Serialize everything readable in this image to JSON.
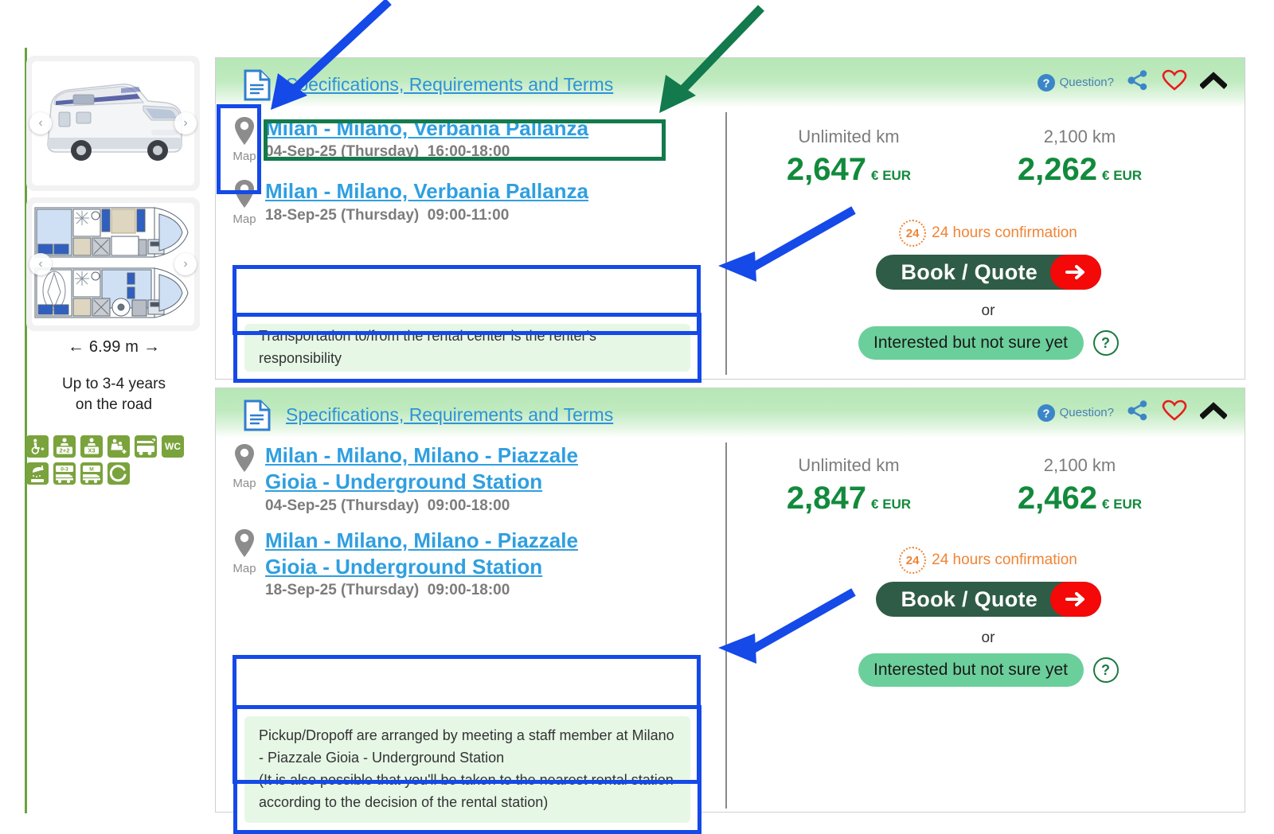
{
  "sidebar": {
    "vehicle_photo_alt": "motorhome-exterior-photo",
    "floorplan_alt": "motorhome-floorplan",
    "prev_label": "‹",
    "next_label": "›",
    "length_text": "6.99 m",
    "length_arrow_left": "←",
    "length_arrow_right": "→",
    "age_line1": "Up to 3-4 years",
    "age_line2": "on the road",
    "badges": [
      {
        "name": "wheelchair-plus-icon",
        "text": ""
      },
      {
        "name": "berths-2plus2-icon",
        "text": "2+2"
      },
      {
        "name": "seats-x3-icon",
        "text": "X3"
      },
      {
        "name": "family-plus-icon",
        "text": ""
      },
      {
        "name": "vehicle-length-icon",
        "text": ""
      },
      {
        "name": "toilet-wc-icon",
        "text": "WC"
      },
      {
        "name": "shower-icon",
        "text": ""
      },
      {
        "name": "age-0-3-icon",
        "text": "0-3"
      },
      {
        "name": "manual-transmission-icon",
        "text": "M"
      },
      {
        "name": "refresh-c-icon",
        "text": "C"
      }
    ]
  },
  "listings": [
    {
      "header": {
        "spec_link": "Specifications, Requirements and Terms",
        "question_label": "Question?",
        "doc_icon": "document-icon",
        "share_icon": "share-icon",
        "favorite_icon": "heart-icon",
        "collapse_icon": "chevron-up-icon"
      },
      "pickup": {
        "name": "Milan - Milano, Verbania Pallanza",
        "name_line2": "",
        "map_label": "Map",
        "date": "04-Sep-25 (Thursday)",
        "time": "16:00-18:00"
      },
      "dropoff": {
        "name": "Milan - Milano, Verbania Pallanza",
        "name_line2": "",
        "map_label": "Map",
        "date": "18-Sep-25 (Thursday)",
        "time": "09:00-11:00"
      },
      "note": "Transportation to/from the rental center is the renter's responsibility",
      "prices": [
        {
          "km_label": "Unlimited km",
          "amount": "2,647",
          "currency": "€ EUR"
        },
        {
          "km_label": "2,100 km",
          "amount": "2,262",
          "currency": "€ EUR"
        }
      ],
      "confirmation": {
        "badge": "24",
        "text": "24 hours confirmation"
      },
      "book_label": "Book / Quote",
      "or_label": "or",
      "interested_label": "Interested but not sure yet",
      "help_label": "?"
    },
    {
      "header": {
        "spec_link": "Specifications, Requirements and Terms",
        "question_label": "Question?",
        "doc_icon": "document-icon",
        "share_icon": "share-icon",
        "favorite_icon": "heart-icon",
        "collapse_icon": "chevron-up-icon"
      },
      "pickup": {
        "name": "Milan - Milano, Milano - Piazzale",
        "name_line2": "Gioia - Underground Station",
        "map_label": "Map",
        "date": "04-Sep-25 (Thursday)",
        "time": "09:00-18:00"
      },
      "dropoff": {
        "name": "Milan - Milano, Milano - Piazzale",
        "name_line2": "Gioia - Underground Station",
        "map_label": "Map",
        "date": "18-Sep-25 (Thursday)",
        "time": "09:00-18:00"
      },
      "note": "Pickup/Dropoff are arranged by meeting a staff member at Milano - Piazzale Gioia - Underground Station\n(It is also possible that you'll be taken to the nearest rental station according to the decision of the rental station)",
      "prices": [
        {
          "km_label": "Unlimited km",
          "amount": "2,847",
          "currency": "€ EUR"
        },
        {
          "km_label": "2,100 km",
          "amount": "2,462",
          "currency": "€ EUR"
        }
      ],
      "confirmation": {
        "badge": "24",
        "text": "24 hours confirmation"
      },
      "book_label": "Book / Quote",
      "or_label": "or",
      "interested_label": "Interested but not sure yet",
      "help_label": "?"
    }
  ],
  "annotations": {
    "blue_color": "#1549e8",
    "green_color": "#127a4c",
    "items": [
      {
        "name": "arrow-to-spec-link",
        "color": "#1549e8"
      },
      {
        "name": "arrow-to-location-title",
        "color": "#127a4c"
      },
      {
        "name": "highlight-map-button",
        "color": "#1549e8"
      },
      {
        "name": "highlight-location-title",
        "color": "#127a4c"
      },
      {
        "name": "arrow-to-note-box-1",
        "color": "#1549e8"
      },
      {
        "name": "highlight-note-box-1",
        "color": "#1549e8"
      },
      {
        "name": "arrow-to-note-box-2",
        "color": "#1549e8"
      },
      {
        "name": "highlight-note-box-2",
        "color": "#1549e8"
      }
    ]
  },
  "colors": {
    "accent_green": "#128a3c",
    "link_blue": "#2f9fe0",
    "book_button": "#2f5c46",
    "arrow_red": "#f40808",
    "orange": "#ef8435",
    "header_green": "#b6e7b6"
  }
}
